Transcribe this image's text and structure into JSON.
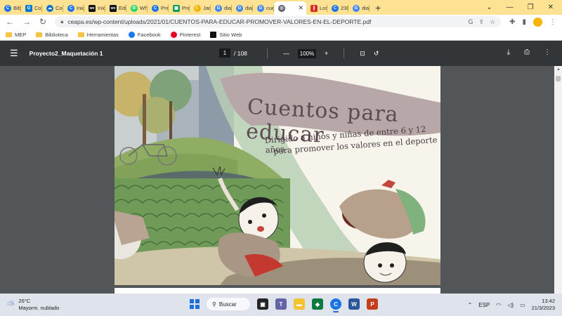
{
  "browser": {
    "tabs": [
      {
        "label": "Bibl",
        "icon": "chrome-icon",
        "color": "#1a73e8"
      },
      {
        "label": "Co",
        "icon": "outlook-icon",
        "color": "#0078d4"
      },
      {
        "label": "Cor",
        "icon": "cloud-icon",
        "color": "#0a6ed1"
      },
      {
        "label": "Inic",
        "icon": "chrome-icon",
        "color": "#1a73e8"
      },
      {
        "label": "Inic",
        "icon": "wix-icon",
        "color": "#111111"
      },
      {
        "label": "Edit",
        "icon": "wix-icon",
        "color": "#111111"
      },
      {
        "label": "Wh",
        "icon": "whatsapp-icon",
        "color": "#25d366"
      },
      {
        "label": "Pre",
        "icon": "chrome-icon",
        "color": "#1a73e8"
      },
      {
        "label": "Pre",
        "icon": "sheets-icon",
        "color": "#0f9d58"
      },
      {
        "label": "Jan",
        "icon": "moon-icon",
        "color": "#f0b400"
      },
      {
        "label": "dia",
        "icon": "google-icon",
        "color": "#4285f4"
      },
      {
        "label": "dia",
        "icon": "google-icon",
        "color": "#4285f4"
      },
      {
        "label": "cue",
        "icon": "google-icon",
        "color": "#4285f4"
      },
      {
        "label": "",
        "icon": "globe-icon",
        "color": "#5f6368",
        "active": true
      },
      {
        "label": "Los",
        "icon": "bars-icon",
        "color": "#d93025"
      },
      {
        "label": "230",
        "icon": "chrome-icon",
        "color": "#1a73e8"
      },
      {
        "label": "dia",
        "icon": "google-icon",
        "color": "#4285f4"
      }
    ],
    "url": "ceapa.es/wp-content/uploads/2021/01/CUENTOS-PARA-EDUCAR-PROMOVER-VALORES-EN-EL-DEPORTE.pdf",
    "bookmarks": [
      {
        "label": "MEP",
        "icon": "folder-icon"
      },
      {
        "label": "Biblioteca",
        "icon": "folder-icon"
      },
      {
        "label": "Herramientas",
        "icon": "folder-icon"
      },
      {
        "label": "Facebook",
        "icon": "facebook-icon"
      },
      {
        "label": "Pinterest",
        "icon": "pinterest-icon"
      },
      {
        "label": "Sitio Web",
        "icon": "wix-icon"
      }
    ]
  },
  "pdf": {
    "title": "Proyecto2_Maquetación 1",
    "page_current": "1",
    "page_total": "/ 108",
    "zoom": "100%"
  },
  "cover": {
    "title": "Cuentos para educar",
    "subtitle_line1": "Dirigido a niños y niñas de entre 6 y 12 años",
    "subtitle_line2": "para promover los valores en el deporte"
  },
  "taskbar": {
    "temperature": "26°C",
    "weather": "Mayorm. nublado",
    "search_label": "Buscar",
    "language": "ESP",
    "time": "13:42",
    "date": "21/3/2023"
  },
  "colors": {
    "tabstrip": "#fde293",
    "pdf_toolbar": "#323639",
    "viewer_bg": "#525659",
    "cover_band": "#b8a7a8",
    "cover_green": "#8fae63"
  }
}
